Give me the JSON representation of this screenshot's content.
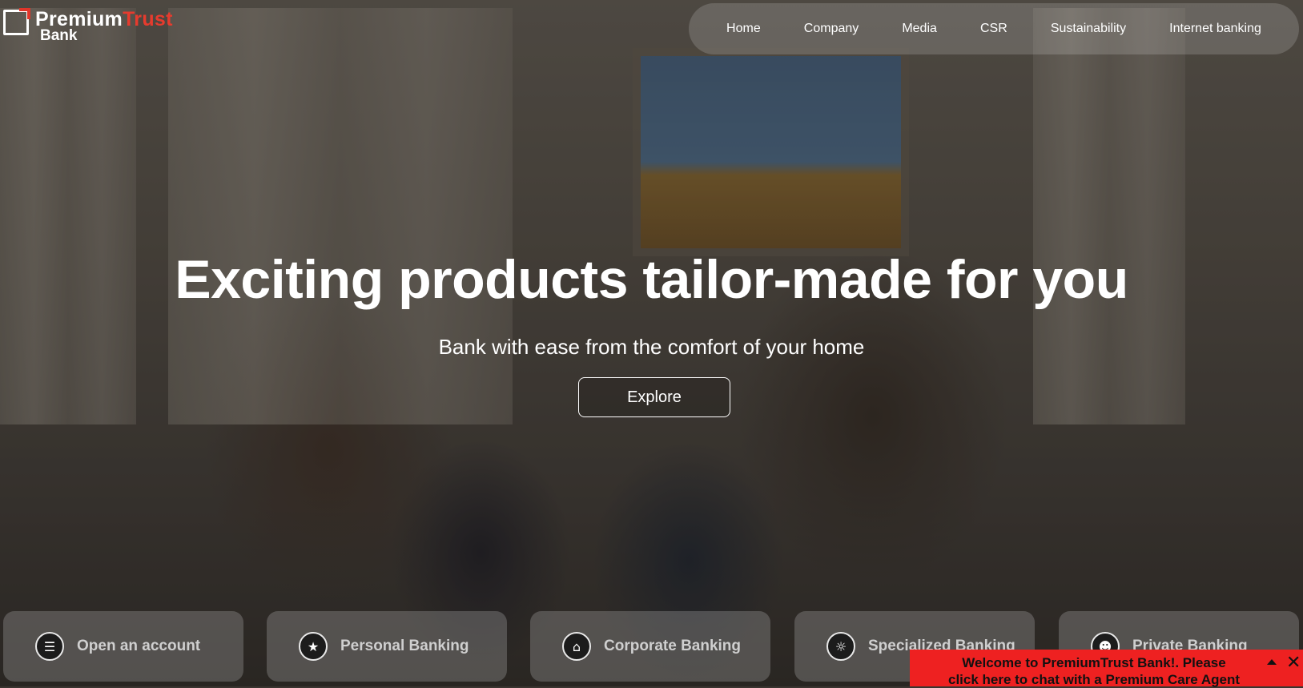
{
  "brand": {
    "name_part1": "Premium",
    "name_part2": "Trust",
    "name_part3": "Bank",
    "accent_color": "#e63b2e"
  },
  "nav": {
    "items": [
      "Home",
      "Company",
      "Media",
      "CSR",
      "Sustainability",
      "Internet banking"
    ]
  },
  "hero": {
    "title": "Exciting products tailor-made for you",
    "subtitle": "Bank with ease from the comfort of your home",
    "cta_label": "Explore"
  },
  "cards": [
    {
      "label": "Open an account",
      "icon": "document-add-icon"
    },
    {
      "label": "Personal Banking",
      "icon": "piggy-bank-icon"
    },
    {
      "label": "Corporate Banking",
      "icon": "bank-building-icon"
    },
    {
      "label": "Specialized Banking",
      "icon": "lightbulb-gear-icon"
    },
    {
      "label": "Private Banking",
      "icon": "people-icon"
    }
  ],
  "chat": {
    "line1": "Welcome to PremiumTrust Bank!. Please",
    "line2": "click here to chat with a Premium Care Agent",
    "color": "#ee2121"
  }
}
